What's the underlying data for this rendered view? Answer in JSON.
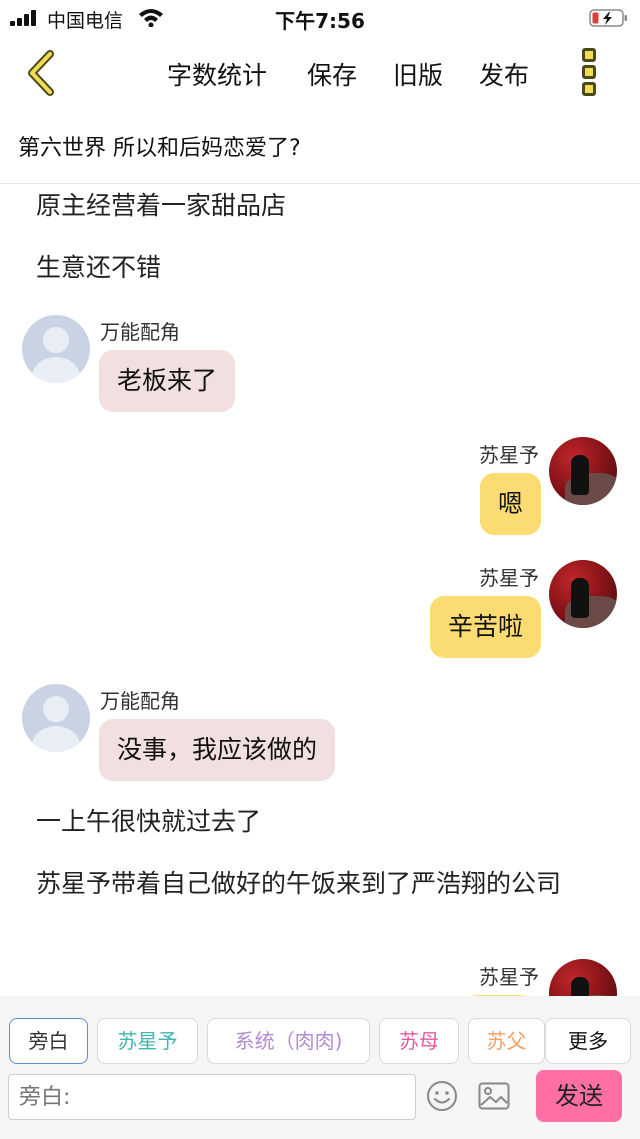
{
  "status_bar": {
    "carrier": "中国电信",
    "time": "下午7:56"
  },
  "navbar": {
    "word_count": "字数统计",
    "save": "保存",
    "old_version": "旧版",
    "publish": "发布"
  },
  "chapter_title": "第六世界  所以和后妈恋爱了?",
  "messages": [
    {
      "type": "narration",
      "text": "原主经营着一家甜品店"
    },
    {
      "type": "narration",
      "text": "生意还不错"
    },
    {
      "type": "left",
      "name": "万能配角",
      "text": "老板来了"
    },
    {
      "type": "right",
      "name": "苏星予",
      "text": "嗯"
    },
    {
      "type": "right",
      "name": "苏星予",
      "text": "辛苦啦"
    },
    {
      "type": "left",
      "name": "万能配角",
      "text": "没事，我应该做的"
    },
    {
      "type": "narration",
      "text": "一上午很快就过去了"
    },
    {
      "type": "narration",
      "text": "苏星予带着自己做好的午饭来到了严浩翔的公司"
    },
    {
      "type": "right",
      "name": "苏星予",
      "text": ""
    }
  ],
  "roles": [
    {
      "label": "旁白",
      "color": "#333333"
    },
    {
      "label": "苏星予",
      "color": "#3fb6b0"
    },
    {
      "label": "系统（肉肉)",
      "color": "#b48ad6"
    },
    {
      "label": "苏母",
      "color": "#e05aa0"
    },
    {
      "label": "苏父",
      "color": "#f0a264"
    },
    {
      "label": "更多",
      "color": "#111111"
    }
  ],
  "composer": {
    "placeholder": "旁白:",
    "send": "发送"
  },
  "colors": {
    "accent": "#f2dc55",
    "left_bubble": "#f2dfdf",
    "right_bubble": "#fbdc72",
    "send": "#ff6fa4"
  }
}
